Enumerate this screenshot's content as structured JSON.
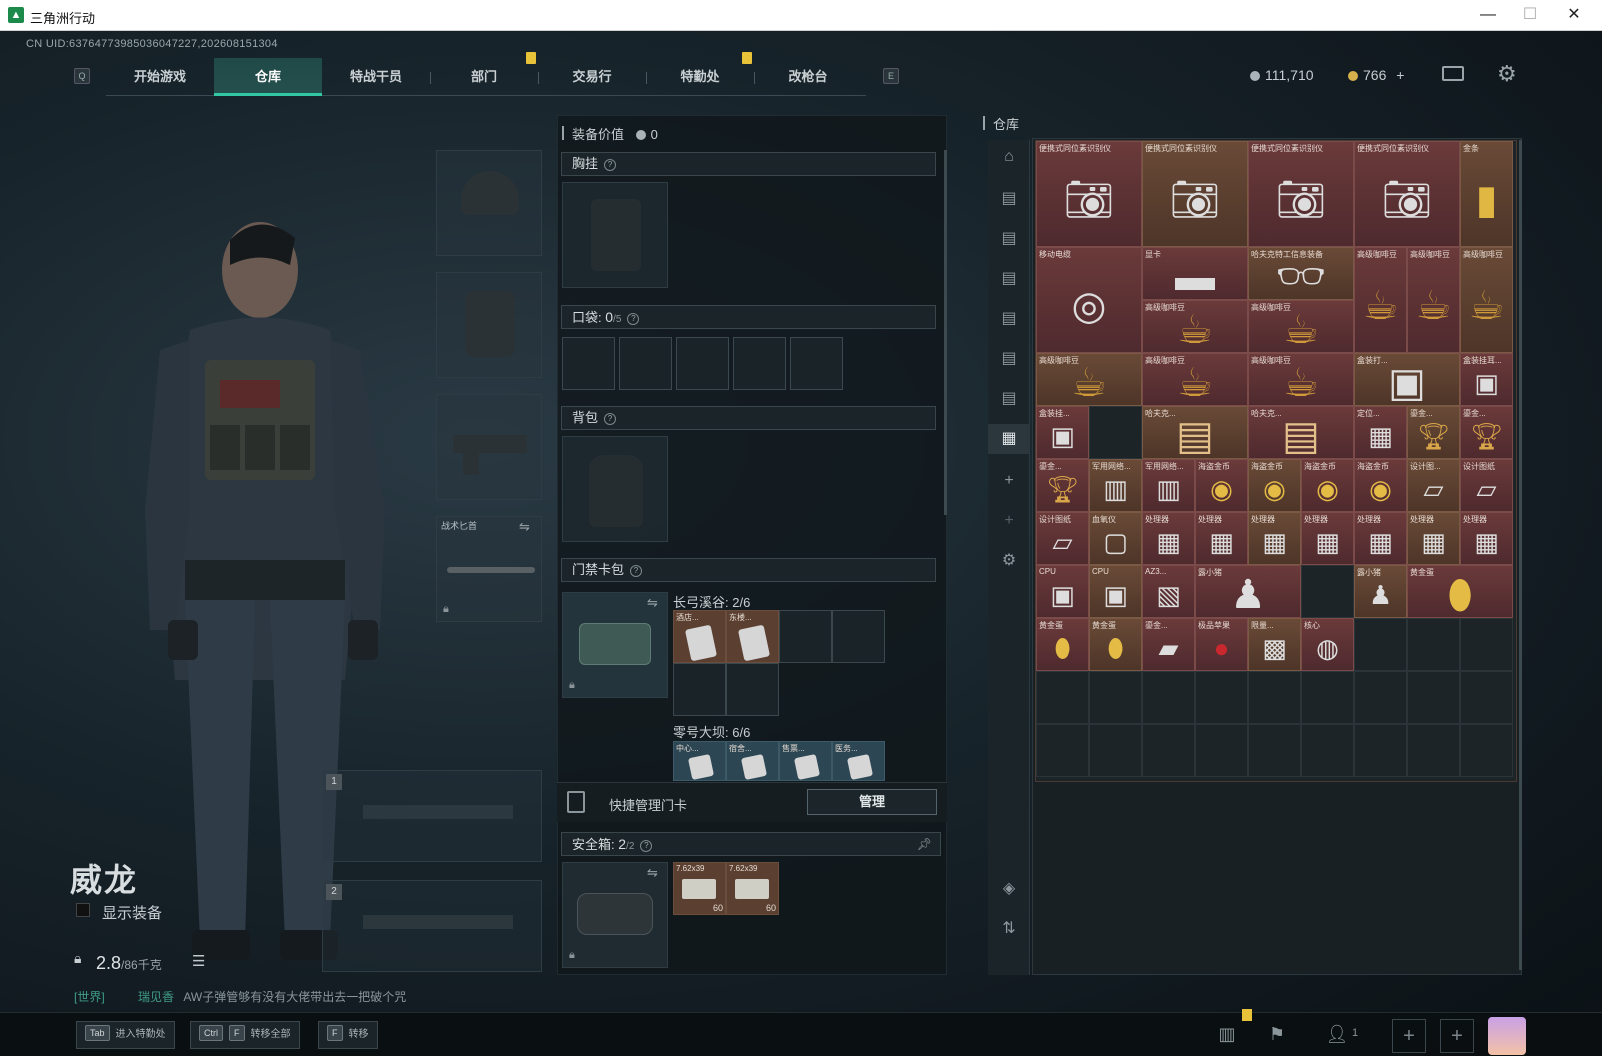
{
  "window": {
    "title": "三角洲行动",
    "minimize": "—",
    "maximize": "☐",
    "close": "✕"
  },
  "uid": "CN UID:6376477398503604​7227,202608151304",
  "nav": {
    "left_key": "Q",
    "right_key": "E",
    "tabs": [
      "开始游戏",
      "仓库",
      "特战干员",
      "部门",
      "交易行",
      "特勤处",
      "改枪台"
    ],
    "active_tab": "仓库"
  },
  "currency": {
    "silver": "111,710",
    "gold": "766",
    "plus": "+"
  },
  "character": {
    "name": "威龙",
    "show_equipment": "显示装备",
    "weight": "2.8",
    "weight_max": "/86千克",
    "melee_label": "战术匕首",
    "weapon_slot_1": "1",
    "weapon_slot_2": "2"
  },
  "chat": {
    "channel": "[世界]",
    "user": "瑞见香",
    "message": "AW子弹管够有没有大佬带出去一把破个咒"
  },
  "equipment": {
    "value_label": "装备价值",
    "value": "0",
    "chest_rig": "胸挂",
    "pocket_label": "口袋:",
    "pocket_count": "0",
    "pocket_max": "/5",
    "backpack": "背包",
    "keycard_bag": "门禁卡包",
    "keycard_group1": "长弓溪谷: 2/6",
    "keycard_group2": "零号大坝: 6/6",
    "kc1": [
      "酒店...",
      "东楼..."
    ],
    "kc2": [
      "中心...",
      "宿舍...",
      "售票...",
      "医务..."
    ],
    "quick_manage": "快捷管理门卡",
    "manage_button": "管理",
    "safebox_label": "安全箱:",
    "safebox_count": "2",
    "safebox_max": "/2",
    "ammo": [
      {
        "name": "7.62x39",
        "count": "60"
      },
      {
        "name": "7.62x39",
        "count": "60"
      }
    ]
  },
  "warehouse": {
    "title": "仓库",
    "items": [
      {
        "label": "便携式同位素识别仪",
        "icon": "camera-device"
      },
      {
        "label": "便携式同位素识别仪",
        "icon": "camera-device"
      },
      {
        "label": "便携式同位素识别仪",
        "icon": "camera-device"
      },
      {
        "label": "便携式同位素识别仪",
        "icon": "camera-device"
      },
      {
        "label": "金条",
        "icon": "gold-bar"
      },
      {
        "label": "移动电缆",
        "icon": "cable-reel"
      },
      {
        "label": "显卡",
        "icon": "graphics-card"
      },
      {
        "label": "哈夫克特工信息装备",
        "icon": "glasses"
      },
      {
        "label": "高级咖啡豆",
        "icon": "coffee-bag"
      },
      {
        "label": "高级咖啡豆",
        "icon": "coffee-bag"
      },
      {
        "label": "高级咖啡豆",
        "icon": "coffee-bag"
      },
      {
        "label": "高级咖啡豆",
        "icon": "coffee-bag"
      },
      {
        "label": "高级咖啡豆",
        "icon": "coffee-bag"
      },
      {
        "label": "高级咖啡豆",
        "icon": "coffee-bag"
      },
      {
        "label": "高级咖啡豆",
        "icon": "coffee-bag"
      },
      {
        "label": "高级咖啡豆",
        "icon": "coffee-bag"
      },
      {
        "label": "盒装打...",
        "icon": "box"
      },
      {
        "label": "盒装挂耳...",
        "icon": "box"
      },
      {
        "label": "盒装挂...",
        "icon": "box"
      },
      {
        "label": "哈夫克...",
        "icon": "document"
      },
      {
        "label": "哈夫克...",
        "icon": "document"
      },
      {
        "label": "定位...",
        "icon": "device"
      },
      {
        "label": "鎏金...",
        "icon": "trophy"
      },
      {
        "label": "鎏金...",
        "icon": "trophy"
      },
      {
        "label": "鎏金...",
        "icon": "trophy"
      },
      {
        "label": "军用网络...",
        "icon": "router"
      },
      {
        "label": "军用网络...",
        "icon": "router"
      },
      {
        "label": "海盗金币",
        "icon": "coin"
      },
      {
        "label": "海盗金币",
        "icon": "coin"
      },
      {
        "label": "海盗金币",
        "icon": "coin"
      },
      {
        "label": "海盗金币",
        "icon": "coin"
      },
      {
        "label": "设计图...",
        "icon": "blueprint"
      },
      {
        "label": "设计图纸",
        "icon": "blueprint"
      },
      {
        "label": "设计图纸",
        "icon": "blueprint"
      },
      {
        "label": "血氧仪",
        "icon": "oximeter"
      },
      {
        "label": "处理器",
        "icon": "processor"
      },
      {
        "label": "处理器",
        "icon": "processor"
      },
      {
        "label": "处理器",
        "icon": "processor"
      },
      {
        "label": "处理器",
        "icon": "processor"
      },
      {
        "label": "处理器",
        "icon": "processor"
      },
      {
        "label": "处理器",
        "icon": "processor"
      },
      {
        "label": "处理器",
        "icon": "processor"
      },
      {
        "label": "CPU",
        "icon": "cpu"
      },
      {
        "label": "CPU",
        "icon": "cpu"
      },
      {
        "label": "AZ3...",
        "icon": "map"
      },
      {
        "label": "露小猪",
        "icon": "figure"
      },
      {
        "label": "露小猪",
        "icon": "figure"
      },
      {
        "label": "黄金蛋",
        "icon": "golden-egg"
      },
      {
        "label": "黄金蛋",
        "icon": "golden-egg"
      },
      {
        "label": "黄金蛋",
        "icon": "golden-egg"
      },
      {
        "label": "鎏金...",
        "icon": "card"
      },
      {
        "label": "极品苹果",
        "icon": "apple"
      },
      {
        "label": "限量...",
        "icon": "poster"
      },
      {
        "label": "核心",
        "icon": "sphere"
      }
    ]
  },
  "bottom": {
    "btn1_key": "Tab",
    "btn1_label": "进入特勤处",
    "btn2_key1": "Ctrl",
    "btn2_key2": "F",
    "btn2_label": "转移全部",
    "btn3_key": "F",
    "btn3_label": "转移",
    "squad_count": "1"
  }
}
